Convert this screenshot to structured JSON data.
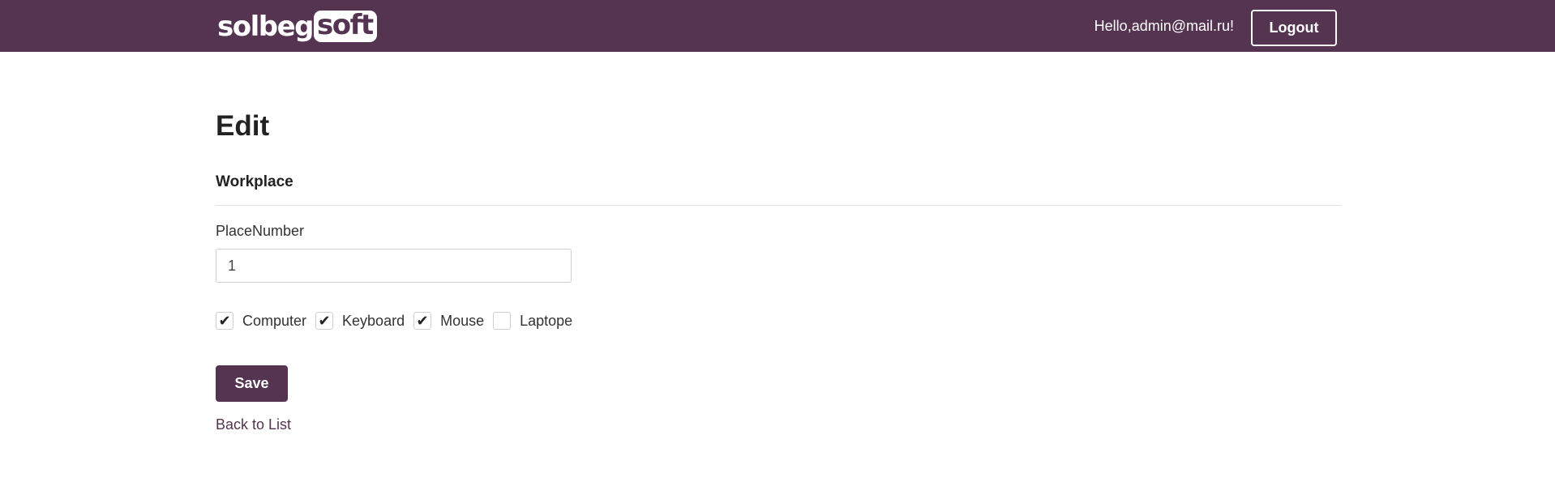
{
  "colors": {
    "brand": "#543450",
    "text": "#222222"
  },
  "header": {
    "logo_part1": "solbeg",
    "logo_part2": "soft",
    "greeting": "Hello,admin@mail.ru!",
    "logout_label": "Logout"
  },
  "main": {
    "title": "Edit",
    "subtitle": "Workplace",
    "place_number_label": "PlaceNumber",
    "place_number_value": "1",
    "checkboxes": [
      {
        "label": "Computer",
        "checked": true,
        "mark": "✔"
      },
      {
        "label": "Keyboard",
        "checked": true,
        "mark": "✔"
      },
      {
        "label": "Mouse",
        "checked": true,
        "mark": "✔"
      },
      {
        "label": "Laptope",
        "checked": false,
        "mark": ""
      }
    ],
    "save_label": "Save",
    "back_link": "Back to List"
  }
}
